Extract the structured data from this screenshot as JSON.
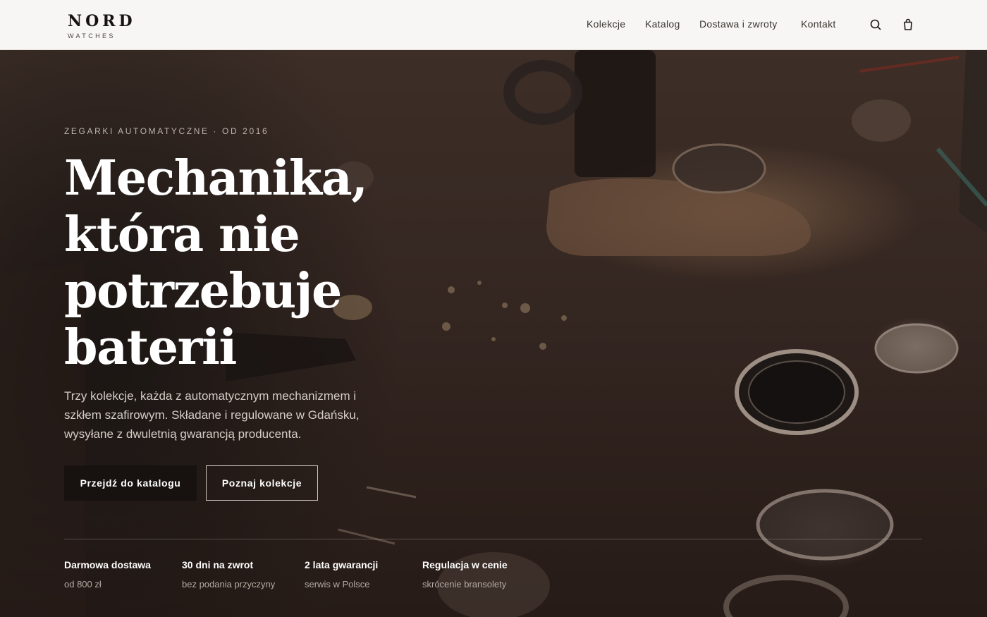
{
  "brand": {
    "name": "NORD",
    "tagline": "WATCHES"
  },
  "nav": {
    "items": [
      {
        "label": "Kolekcje"
      },
      {
        "label": "Katalog"
      },
      {
        "label": "Dostawa i zwroty"
      },
      {
        "label": "Kontakt"
      }
    ],
    "search_icon": "search-icon",
    "cart_icon": "shopping-bag-icon"
  },
  "hero": {
    "eyebrow": "ZEGARKI AUTOMATYCZNE · OD 2016",
    "headline": "Mechanika, która nie potrzebuje baterii",
    "lead": "Trzy kolekcje, każda z automatycznym mechanizmem i szkłem szafirowym. Składane i regulowane w Gdańsku, wysyłane z dwuletnią gwarancją producenta.",
    "primary_cta": "Przejdź do katalogu",
    "secondary_cta": "Poznaj kolekcje"
  },
  "features": [
    {
      "title": "Darmowa dostawa",
      "subtitle": "od 800 zł"
    },
    {
      "title": "30 dni na zwrot",
      "subtitle": "bez podania przyczyny"
    },
    {
      "title": "2 lata gwarancji",
      "subtitle": "serwis w Polsce"
    },
    {
      "title": "Regulacja w cenie",
      "subtitle": "skrócenie bransolety"
    }
  ],
  "colors": {
    "header_bg": "#f7f6f4",
    "hero_overlay": "#2b201c",
    "primary_button": "#17120f",
    "text_light": "#ffffff"
  }
}
